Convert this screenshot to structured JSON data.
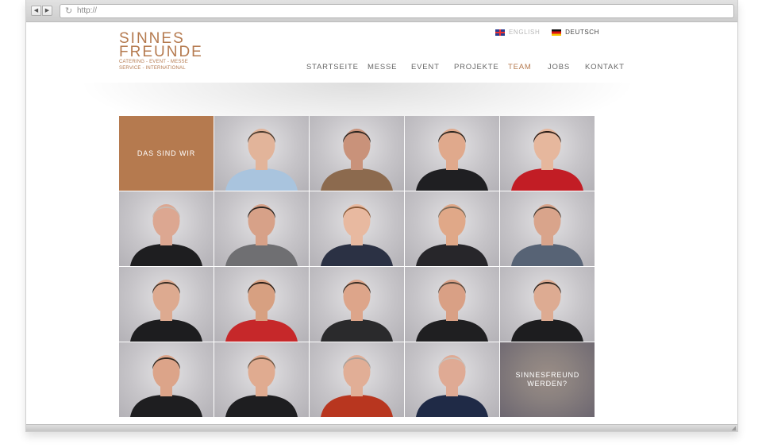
{
  "browser": {
    "url": "http://",
    "back_label": "◀",
    "forward_label": "▶",
    "reload_icon": "reload-icon"
  },
  "site": {
    "logo": {
      "line1": "SINNES",
      "line2": "FREUNDE",
      "tagline1": "CATERING - EVENT - MESSE",
      "tagline2": "SERVICE - INTERNATIONAL"
    },
    "languages": [
      {
        "label": "ENGLISH",
        "flag": "uk-flag-icon"
      },
      {
        "label": "DEUTSCH",
        "flag": "de-flag-icon"
      }
    ],
    "nav": [
      {
        "label": "STARTSEITE"
      },
      {
        "label": "MESSE"
      },
      {
        "label": "EVENT"
      },
      {
        "label": "PROJEKTE"
      },
      {
        "label": "TEAM",
        "active": true
      },
      {
        "label": "JOBS"
      },
      {
        "label": "KONTAKT"
      }
    ],
    "accent_color": "#b57a4f"
  },
  "team": {
    "intro_label": "DAS SIND WIR",
    "join_label": "SINNESFREUND WERDEN?",
    "members": [
      {
        "shirt": "#a9c4de",
        "hair": "#4a3a2e",
        "skin": "#e2b49a"
      },
      {
        "shirt": "#8c6a4e",
        "hair": "#2a241f",
        "skin": "#c9927a"
      },
      {
        "shirt": "#1f1f22",
        "hair": "#2c2620",
        "skin": "#e0a98c"
      },
      {
        "shirt": "#c21d25",
        "hair": "#2a1c16",
        "skin": "#e6b79d"
      },
      {
        "shirt": "#1e1e20",
        "hair": "#c7b9b0",
        "skin": "#dca791"
      },
      {
        "shirt": "#6f6f72",
        "hair": "#2b2521",
        "skin": "#d7a188"
      },
      {
        "shirt": "#2b3144",
        "hair": "#8a5a38",
        "skin": "#e8b9a0"
      },
      {
        "shirt": "#27262a",
        "hair": "#7a6a58",
        "skin": "#e0a888"
      },
      {
        "shirt": "#576375",
        "hair": "#4a3d33",
        "skin": "#d9a48b"
      },
      {
        "shirt": "#1d1d1f",
        "hair": "#3a2e24",
        "skin": "#ddaa90"
      },
      {
        "shirt": "#c6282a",
        "hair": "#2a1e17",
        "skin": "#d7a081"
      },
      {
        "shirt": "#2a2a2c",
        "hair": "#3b2f26",
        "skin": "#dda58a"
      },
      {
        "shirt": "#1f1f21",
        "hair": "#5a4a3e",
        "skin": "#d9a085"
      },
      {
        "shirt": "#1d1d1f",
        "hair": "#2d251f",
        "skin": "#ddab92"
      },
      {
        "shirt": "#1e1e20",
        "hair": "#2f2720",
        "skin": "#dca489"
      },
      {
        "shirt": "#1e1e20",
        "hair": "#6b5340",
        "skin": "#e0ab90"
      },
      {
        "shirt": "#b8361f",
        "hair": "#a8a09a",
        "skin": "#e1ae96"
      },
      {
        "shirt": "#1f2a46",
        "hair": "#c9c0ba",
        "skin": "#dfaa94"
      }
    ]
  }
}
